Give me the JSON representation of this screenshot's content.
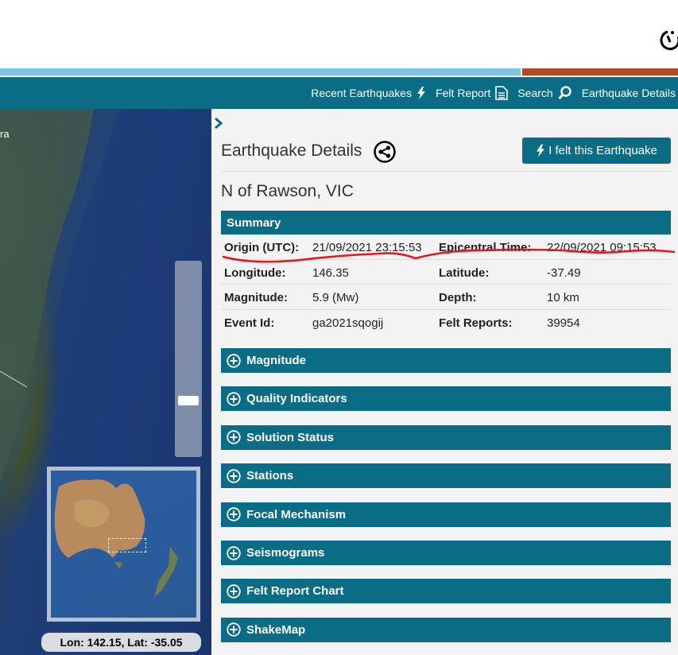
{
  "nav": {
    "items": [
      {
        "label": "Recent Earthquakes",
        "icon": "lightning-icon"
      },
      {
        "label": "Felt Report",
        "icon": "document-icon"
      },
      {
        "label": "Search",
        "icon": "search-icon"
      },
      {
        "label": "Earthquake Details",
        "icon": ""
      }
    ]
  },
  "map": {
    "edge_label": "ra",
    "coordinates": "Lon: 142.15, Lat: -35.05"
  },
  "panel": {
    "title": "Earthquake Details",
    "felt_button": "I felt this Earthquake",
    "location": "N of Rawson, VIC",
    "summary_label": "Summary",
    "summary": [
      {
        "k1": "Origin (UTC):",
        "v1": "21/09/2021 23:15:53",
        "k2": "Epicentral Time:",
        "v2": "22/09/2021 09:15:53"
      },
      {
        "k1": "Longitude:",
        "v1": "146.35",
        "k2": "Latitude:",
        "v2": "-37.49"
      },
      {
        "k1": "Magnitude:",
        "v1": "5.9 (Mw)",
        "k2": "Depth:",
        "v2": "10 km"
      },
      {
        "k1": "Event Id:",
        "v1": "ga2021sqogij",
        "k2": "Felt Reports:",
        "v2": "39954"
      }
    ],
    "sections": [
      "Magnitude",
      "Quality Indicators",
      "Solution Status",
      "Stations",
      "Focal Mechanism",
      "Seismograms",
      "Felt Report Chart",
      "ShakeMap"
    ]
  },
  "colors": {
    "nav_bg": "#0b6c86",
    "stripe_blue": "#7fc4e3",
    "stripe_brown": "#b34a24",
    "annotation": "#e8161b"
  }
}
